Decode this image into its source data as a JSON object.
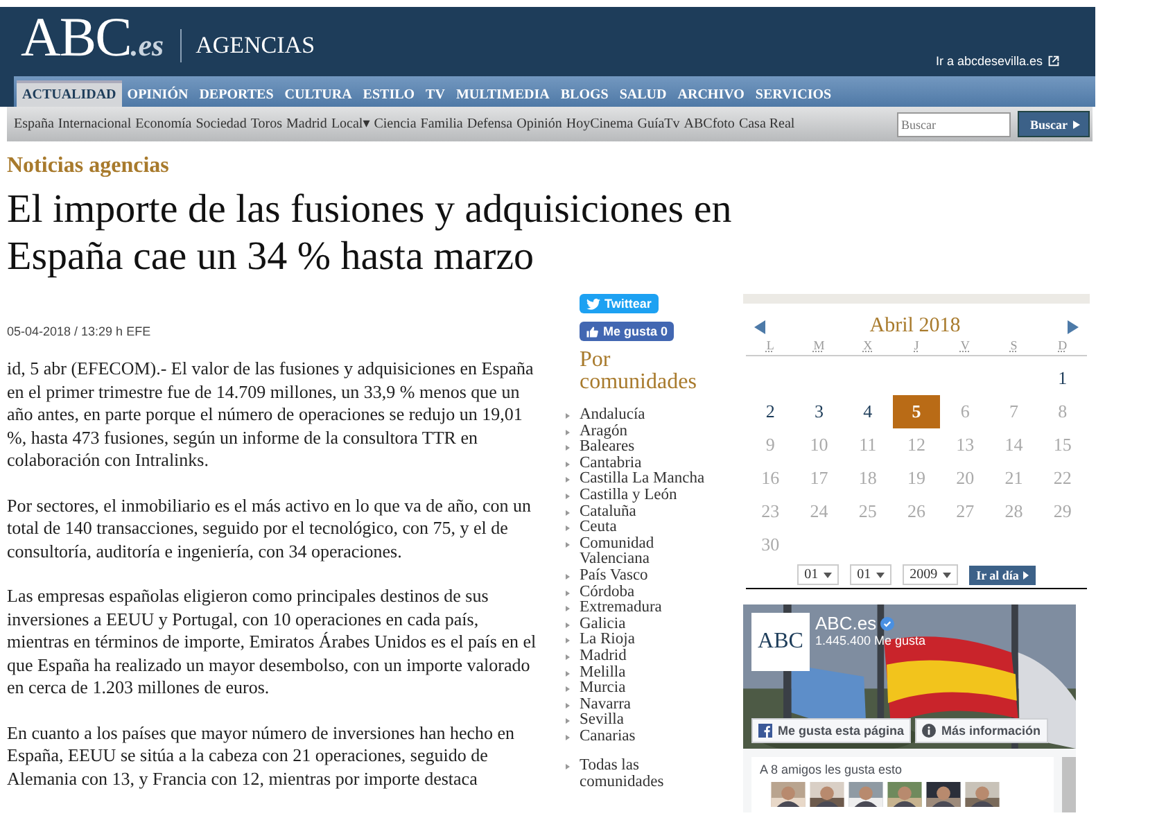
{
  "header": {
    "logo": "ABC",
    "logo_suffix": ".es",
    "section": "AGENCIAS",
    "link": "Ir a abcdesevilla.es"
  },
  "nav": [
    {
      "label": "ACTUALIDAD",
      "selected": true
    },
    {
      "label": "OPINIÓN",
      "selected": false
    },
    {
      "label": "DEPORTES",
      "selected": false
    },
    {
      "label": "CULTURA",
      "selected": false
    },
    {
      "label": "ESTILO",
      "selected": false
    },
    {
      "label": "TV",
      "selected": false
    },
    {
      "label": "MULTIMEDIA",
      "selected": false
    },
    {
      "label": "BLOGS",
      "selected": false
    },
    {
      "label": "SALUD",
      "selected": false
    },
    {
      "label": "ARCHIVO",
      "selected": false
    },
    {
      "label": "SERVICIOS",
      "selected": false
    }
  ],
  "subnav": [
    "España",
    "Internacional",
    "Economía",
    "Sociedad",
    "Toros",
    "Madrid",
    "Local▾",
    "Ciencia",
    "Familia",
    "Defensa",
    "Opinión",
    "HoyCinema",
    "GuíaTv",
    "ABCfoto",
    "Casa Real"
  ],
  "search": {
    "placeholder": "Buscar",
    "button": "Buscar"
  },
  "section_title": "Noticias agencias",
  "headline": "El importe de las fusiones y adquisiciones en España cae un 34 % hasta marzo",
  "dateline": "05-04-2018 / 13:29 h EFE",
  "paragraphs": [
    "id, 5 abr (EFECOM).- El valor de las fusiones y adquisiciones en España en el primer trimestre fue de 14.709 millones, un 33,9 % menos que un año antes, en parte porque el número de operaciones se redujo un 19,01 %, hasta 473 fusiones, según un informe de la consultora TTR en colaboración con Intralinks.",
    "Por sectores, el inmobiliario es el más activo en lo que va de año, con un total de 140 transacciones, seguido por el tecnológico, con 75, y el de consultoría, auditoría e ingeniería, con 34 operaciones.",
    "Las empresas españolas eligieron como principales destinos de sus inversiones a EEUU y Portugal, con 10 operaciones en cada país, mientras en términos de importe, Emiratos Árabes Unidos es el país en el que España ha realizado un mayor desembolso, con un importe valorado en cerca de 1.203 millones de euros.",
    "En cuanto a los países que mayor número de inversiones han hecho en España, EEUU se sitúa a la cabeza con 21 operaciones, seguido de Alemania con 13, y Francia con 12, mientras por importe destaca"
  ],
  "social": {
    "tweet": "Twittear",
    "like": "Me gusta 0"
  },
  "regions": {
    "title": "Por comunidades",
    "items": [
      "Andalucía",
      "Aragón",
      "Baleares",
      "Cantabria",
      "Castilla La Mancha",
      "Castilla y León",
      "Cataluña",
      "Ceuta",
      "Comunidad Valenciana",
      "País Vasco",
      "Córdoba",
      "Extremadura",
      "Galicia",
      "La Rioja",
      "Madrid",
      "Melilla",
      "Murcia",
      "Navarra",
      "Sevilla",
      "Canarias"
    ],
    "all": "Todas las comunidades"
  },
  "calendar": {
    "month": "Abril 2018",
    "weekdays": [
      "L",
      "M",
      "X",
      "J",
      "V",
      "S",
      "D"
    ],
    "weeks": [
      [
        {
          "kind": "blank"
        },
        {
          "kind": "blank"
        },
        {
          "kind": "blank"
        },
        {
          "kind": "blank"
        },
        {
          "kind": "blank"
        },
        {
          "kind": "blank"
        },
        {
          "kind": "day",
          "text": "1",
          "linked": true,
          "selected": false
        }
      ],
      [
        {
          "kind": "day",
          "text": "2",
          "linked": true,
          "selected": false
        },
        {
          "kind": "day",
          "text": "3",
          "linked": true,
          "selected": false
        },
        {
          "kind": "day",
          "text": "4",
          "linked": true,
          "selected": false
        },
        {
          "kind": "day",
          "text": "5",
          "linked": true,
          "selected": true
        },
        {
          "kind": "day",
          "text": "6",
          "linked": false,
          "selected": false
        },
        {
          "kind": "day",
          "text": "7",
          "linked": false,
          "selected": false
        },
        {
          "kind": "day",
          "text": "8",
          "linked": false,
          "selected": false
        }
      ],
      [
        {
          "kind": "day",
          "text": "9",
          "linked": false,
          "selected": false
        },
        {
          "kind": "day",
          "text": "10",
          "linked": false,
          "selected": false
        },
        {
          "kind": "day",
          "text": "11",
          "linked": false,
          "selected": false
        },
        {
          "kind": "day",
          "text": "12",
          "linked": false,
          "selected": false
        },
        {
          "kind": "day",
          "text": "13",
          "linked": false,
          "selected": false
        },
        {
          "kind": "day",
          "text": "14",
          "linked": false,
          "selected": false
        },
        {
          "kind": "day",
          "text": "15",
          "linked": false,
          "selected": false
        }
      ],
      [
        {
          "kind": "day",
          "text": "16",
          "linked": false,
          "selected": false
        },
        {
          "kind": "day",
          "text": "17",
          "linked": false,
          "selected": false
        },
        {
          "kind": "day",
          "text": "18",
          "linked": false,
          "selected": false
        },
        {
          "kind": "day",
          "text": "19",
          "linked": false,
          "selected": false
        },
        {
          "kind": "day",
          "text": "20",
          "linked": false,
          "selected": false
        },
        {
          "kind": "day",
          "text": "21",
          "linked": false,
          "selected": false
        },
        {
          "kind": "day",
          "text": "22",
          "linked": false,
          "selected": false
        }
      ],
      [
        {
          "kind": "day",
          "text": "23",
          "linked": false,
          "selected": false
        },
        {
          "kind": "day",
          "text": "24",
          "linked": false,
          "selected": false
        },
        {
          "kind": "day",
          "text": "25",
          "linked": false,
          "selected": false
        },
        {
          "kind": "day",
          "text": "26",
          "linked": false,
          "selected": false
        },
        {
          "kind": "day",
          "text": "27",
          "linked": false,
          "selected": false
        },
        {
          "kind": "day",
          "text": "28",
          "linked": false,
          "selected": false
        },
        {
          "kind": "day",
          "text": "29",
          "linked": false,
          "selected": false
        }
      ],
      [
        {
          "kind": "day",
          "text": "30",
          "linked": false,
          "selected": false
        }
      ]
    ],
    "selects": [
      "01",
      "01",
      "2009"
    ],
    "go": "Ir al día"
  },
  "facebook": {
    "logo": "ABC",
    "name": "ABC.es",
    "likes": "1.445.400 Me gusta",
    "like_button": "Me gusta esta página",
    "info_button": "Más información",
    "friends": "A 8 amigos les gusta esto"
  }
}
